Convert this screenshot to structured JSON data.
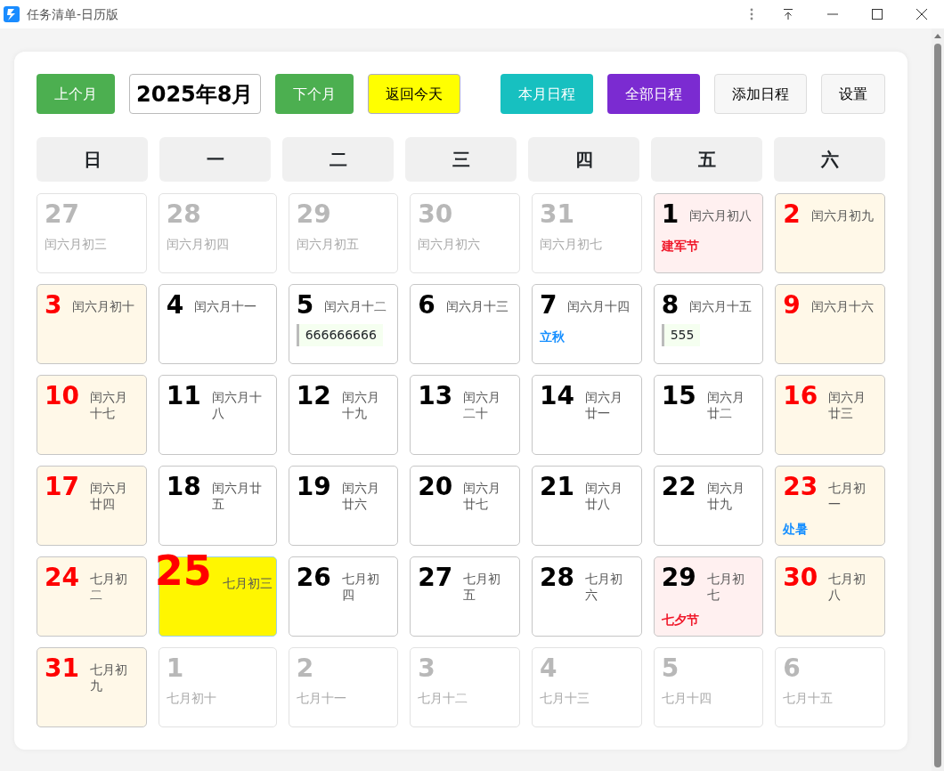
{
  "window": {
    "title": "任务清单-日历版"
  },
  "toolbar": {
    "left": [
      {
        "label": "上个月",
        "kind": "nav"
      },
      {
        "label": "2025年8月",
        "kind": "month"
      },
      {
        "label": "下个月",
        "kind": "nav"
      },
      {
        "label": "返回今天",
        "kind": "today"
      }
    ],
    "right": [
      {
        "label": "本月日程",
        "kind": "teal"
      },
      {
        "label": "全部日程",
        "kind": "purple"
      },
      {
        "label": "添加日程",
        "kind": "plain"
      },
      {
        "label": "设置",
        "kind": "plain"
      }
    ]
  },
  "weekdays": [
    "日",
    "一",
    "二",
    "三",
    "四",
    "五",
    "六"
  ],
  "days": [
    {
      "day": "27",
      "lunar": "闰六月初三",
      "kind": "other"
    },
    {
      "day": "28",
      "lunar": "闰六月初四",
      "kind": "other"
    },
    {
      "day": "29",
      "lunar": "闰六月初五",
      "kind": "other"
    },
    {
      "day": "30",
      "lunar": "闰六月初六",
      "kind": "other"
    },
    {
      "day": "31",
      "lunar": "闰六月初七",
      "kind": "other"
    },
    {
      "day": "1",
      "lunar": "闰六月初八",
      "kind": "holiday",
      "festival": {
        "text": "建军节",
        "kind": "holiday"
      }
    },
    {
      "day": "2",
      "lunar": "闰六月初九",
      "kind": "weekend"
    },
    {
      "day": "3",
      "lunar": "闰六月初十",
      "kind": "weekend"
    },
    {
      "day": "4",
      "lunar": "闰六月十一",
      "kind": "weekday"
    },
    {
      "day": "5",
      "lunar": "闰六月十二",
      "kind": "weekday",
      "events": [
        "666666666"
      ]
    },
    {
      "day": "6",
      "lunar": "闰六月十三",
      "kind": "weekday"
    },
    {
      "day": "7",
      "lunar": "闰六月十四",
      "kind": "weekday",
      "festival": {
        "text": "立秋",
        "kind": "solar_term"
      }
    },
    {
      "day": "8",
      "lunar": "闰六月十五",
      "kind": "weekday",
      "events": [
        "555"
      ]
    },
    {
      "day": "9",
      "lunar": "闰六月十六",
      "kind": "weekend"
    },
    {
      "day": "10",
      "lunar": "闰六月十七",
      "kind": "weekend"
    },
    {
      "day": "11",
      "lunar": "闰六月十八",
      "kind": "weekday"
    },
    {
      "day": "12",
      "lunar": "闰六月十九",
      "kind": "weekday"
    },
    {
      "day": "13",
      "lunar": "闰六月二十",
      "kind": "weekday"
    },
    {
      "day": "14",
      "lunar": "闰六月廿一",
      "kind": "weekday"
    },
    {
      "day": "15",
      "lunar": "闰六月廿二",
      "kind": "weekday"
    },
    {
      "day": "16",
      "lunar": "闰六月廿三",
      "kind": "weekend"
    },
    {
      "day": "17",
      "lunar": "闰六月廿四",
      "kind": "weekend"
    },
    {
      "day": "18",
      "lunar": "闰六月廿五",
      "kind": "weekday"
    },
    {
      "day": "19",
      "lunar": "闰六月廿六",
      "kind": "weekday"
    },
    {
      "day": "20",
      "lunar": "闰六月廿七",
      "kind": "weekday"
    },
    {
      "day": "21",
      "lunar": "闰六月廿八",
      "kind": "weekday"
    },
    {
      "day": "22",
      "lunar": "闰六月廿九",
      "kind": "weekday"
    },
    {
      "day": "23",
      "lunar": "七月初一",
      "kind": "weekend",
      "festival": {
        "text": "处暑",
        "kind": "solar_term"
      }
    },
    {
      "day": "24",
      "lunar": "七月初二",
      "kind": "weekend"
    },
    {
      "day": "25",
      "lunar": "七月初三",
      "kind": "today"
    },
    {
      "day": "26",
      "lunar": "七月初四",
      "kind": "weekday"
    },
    {
      "day": "27",
      "lunar": "七月初五",
      "kind": "weekday"
    },
    {
      "day": "28",
      "lunar": "七月初六",
      "kind": "weekday"
    },
    {
      "day": "29",
      "lunar": "七月初七",
      "kind": "holiday",
      "festival": {
        "text": "七夕节",
        "kind": "holiday"
      }
    },
    {
      "day": "30",
      "lunar": "七月初八",
      "kind": "weekend"
    },
    {
      "day": "31",
      "lunar": "七月初九",
      "kind": "weekend"
    },
    {
      "day": "1",
      "lunar": "七月初十",
      "kind": "other"
    },
    {
      "day": "2",
      "lunar": "七月十一",
      "kind": "other"
    },
    {
      "day": "3",
      "lunar": "七月十二",
      "kind": "other"
    },
    {
      "day": "4",
      "lunar": "七月十三",
      "kind": "other"
    },
    {
      "day": "5",
      "lunar": "七月十四",
      "kind": "other"
    },
    {
      "day": "6",
      "lunar": "七月十五",
      "kind": "other"
    }
  ]
}
